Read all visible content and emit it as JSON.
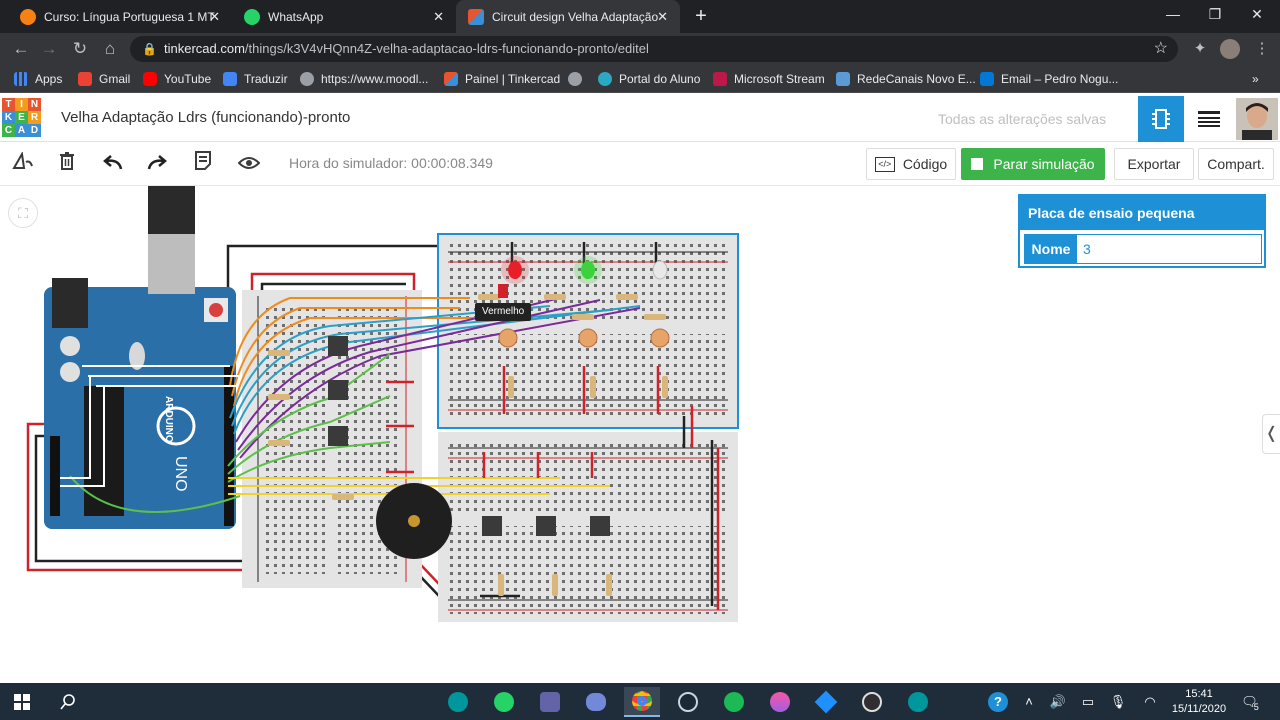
{
  "browser": {
    "tabs": [
      {
        "label": "Curso: Língua Portuguesa 1 MT",
        "icon": "moodle-icon",
        "color": "#f98012"
      },
      {
        "label": "WhatsApp",
        "icon": "whatsapp-icon",
        "color": "#25d366"
      },
      {
        "label": "Circuit design Velha Adaptação L",
        "icon": "tinkercad-icon",
        "color": "#e8542e",
        "active": true
      }
    ],
    "url_host": "tinkercad.com",
    "url_path": "/things/k3V4vHQnn4Z-velha-adaptacao-ldrs-funcionando-pronto/editel",
    "bookmarks": [
      {
        "label": "Apps",
        "icon": "apps-grid-icon",
        "color": "#4285f4"
      },
      {
        "label": "Gmail",
        "icon": "gmail-icon",
        "color": "#ea4335"
      },
      {
        "label": "YouTube",
        "icon": "youtube-icon",
        "color": "#ff0000"
      },
      {
        "label": "Traduzir",
        "icon": "translate-icon",
        "color": "#4285f4"
      },
      {
        "label": "https://www.moodl...",
        "icon": "globe-icon",
        "color": "#9aa0a6"
      },
      {
        "label": "Painel | Tinkercad",
        "icon": "tinkercad-icon",
        "color": "#e8542e"
      },
      {
        "label": "",
        "icon": "globe-icon",
        "color": "#9aa0a6"
      },
      {
        "label": "Portal do Aluno",
        "icon": "portal-icon",
        "color": "#2aa8c4"
      },
      {
        "label": "Microsoft Stream",
        "icon": "stream-icon",
        "color": "#bc1948"
      },
      {
        "label": "RedeCanais Novo E...",
        "icon": "redecanais-icon",
        "color": "#5b9bd5"
      },
      {
        "label": "Email – Pedro Nogu...",
        "icon": "outlook-icon",
        "color": "#0078d4"
      }
    ]
  },
  "header": {
    "logo_letters": [
      "T",
      "I",
      "N",
      "K",
      "E",
      "R",
      "C",
      "A",
      "D"
    ],
    "project_title": "Velha Adaptação Ldrs (funcionando)-pronto",
    "save_status": "Todas as alterações salvas"
  },
  "toolbar": {
    "sim_time": "Hora do simulador: 00:00:08.349",
    "code_label": "Código",
    "stop_label": "Parar simulação",
    "export_label": "Exportar",
    "share_label": "Compart."
  },
  "inspector": {
    "title": "Placa de ensaio pequena",
    "name_label": "Nome",
    "name_value": "3"
  },
  "canvas": {
    "tooltip": "Vermelho",
    "board_labels": [
      "ARDUINO",
      "UNO"
    ],
    "colors": {
      "arduino": "#2a6fa8",
      "breadboard": "#e4e4e4",
      "wire_orange": "#f08c1e",
      "wire_blue": "#2aa0c8",
      "wire_purple": "#7a2a9a",
      "wire_green": "#5cc04a",
      "wire_yellow": "#f0d22a",
      "wire_red": "#d0222a",
      "wire_black": "#222222",
      "led_red": "#e8202a",
      "led_green": "#3bd23b",
      "selection": "#1e90d6"
    }
  },
  "taskbar": {
    "time": "15:41",
    "date": "15/11/2020",
    "notification_count": "5"
  }
}
